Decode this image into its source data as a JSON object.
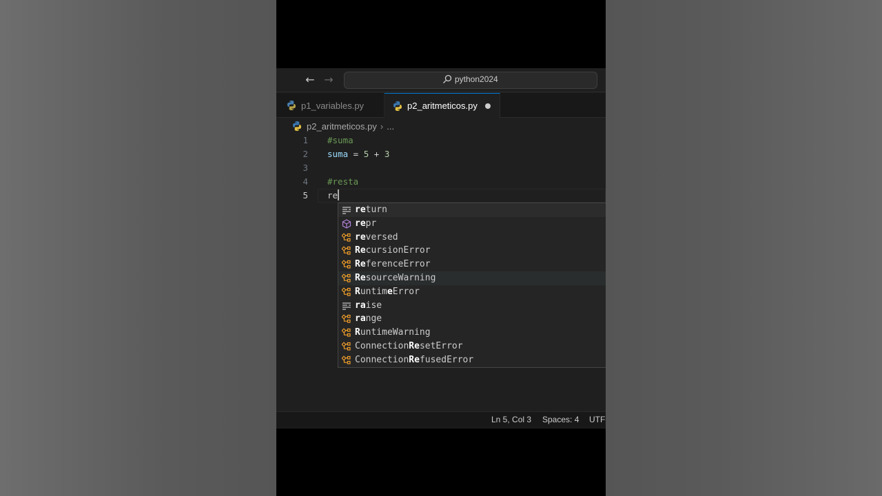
{
  "titlebar": {
    "search_text": "python2024"
  },
  "tabs": [
    {
      "label": "p1_variables.py",
      "active": false
    },
    {
      "label": "p2_aritmeticos.py",
      "active": true,
      "modified": true
    }
  ],
  "breadcrumb": {
    "file": "p2_aritmeticos.py",
    "more": "..."
  },
  "editor": {
    "lines": [
      {
        "number": "1",
        "text": "#suma"
      },
      {
        "number": "2",
        "text": "suma = 5 + 3"
      },
      {
        "number": "3",
        "text": ""
      },
      {
        "number": "4",
        "text": "#resta"
      },
      {
        "number": "5",
        "text": "re"
      }
    ],
    "line2": {
      "var": "suma",
      "eq": "=",
      "a": "5",
      "plus": "+",
      "b": "3"
    }
  },
  "suggestions": [
    {
      "match": "re",
      "rest": "turn",
      "kind": "keyword-icon"
    },
    {
      "match": "re",
      "rest": "pr",
      "kind": "method-icon"
    },
    {
      "match": "re",
      "rest": "versed",
      "kind": "class-icon"
    },
    {
      "match": "Re",
      "rest": "cursionError",
      "kind": "class-icon"
    },
    {
      "match": "Re",
      "rest": "ferenceError",
      "kind": "class-icon"
    },
    {
      "match": "Re",
      "rest": "sourceWarning",
      "kind": "class-icon"
    },
    {
      "match": "R",
      "rest": "untimeError",
      "kind": "class-icon",
      "split": [
        "R",
        "untim",
        "e",
        "Error"
      ]
    },
    {
      "match": "ra",
      "rest": "ise",
      "kind": "keyword-icon"
    },
    {
      "match": "ra",
      "rest": "nge",
      "kind": "class-icon"
    },
    {
      "match": "R",
      "rest": "untimeWarning",
      "kind": "class-icon"
    },
    {
      "prefix": "ConnectionR",
      "mid": "e",
      "rest": "setError",
      "kind": "class-icon"
    },
    {
      "prefix": "ConnectionR",
      "mid": "e",
      "rest": "fusedError",
      "kind": "class-icon"
    }
  ],
  "statusbar": {
    "position": "Ln 5, Col 3",
    "spaces": "Spaces: 4",
    "encoding": "UTF-"
  },
  "colors": {
    "accent": "#0078d4",
    "editor_bg": "#1f1f1f",
    "comment": "#6a9955",
    "variable": "#9cdcfe",
    "number": "#b5cea8",
    "class_icon": "#ee9d28",
    "method_icon": "#b180d7"
  }
}
